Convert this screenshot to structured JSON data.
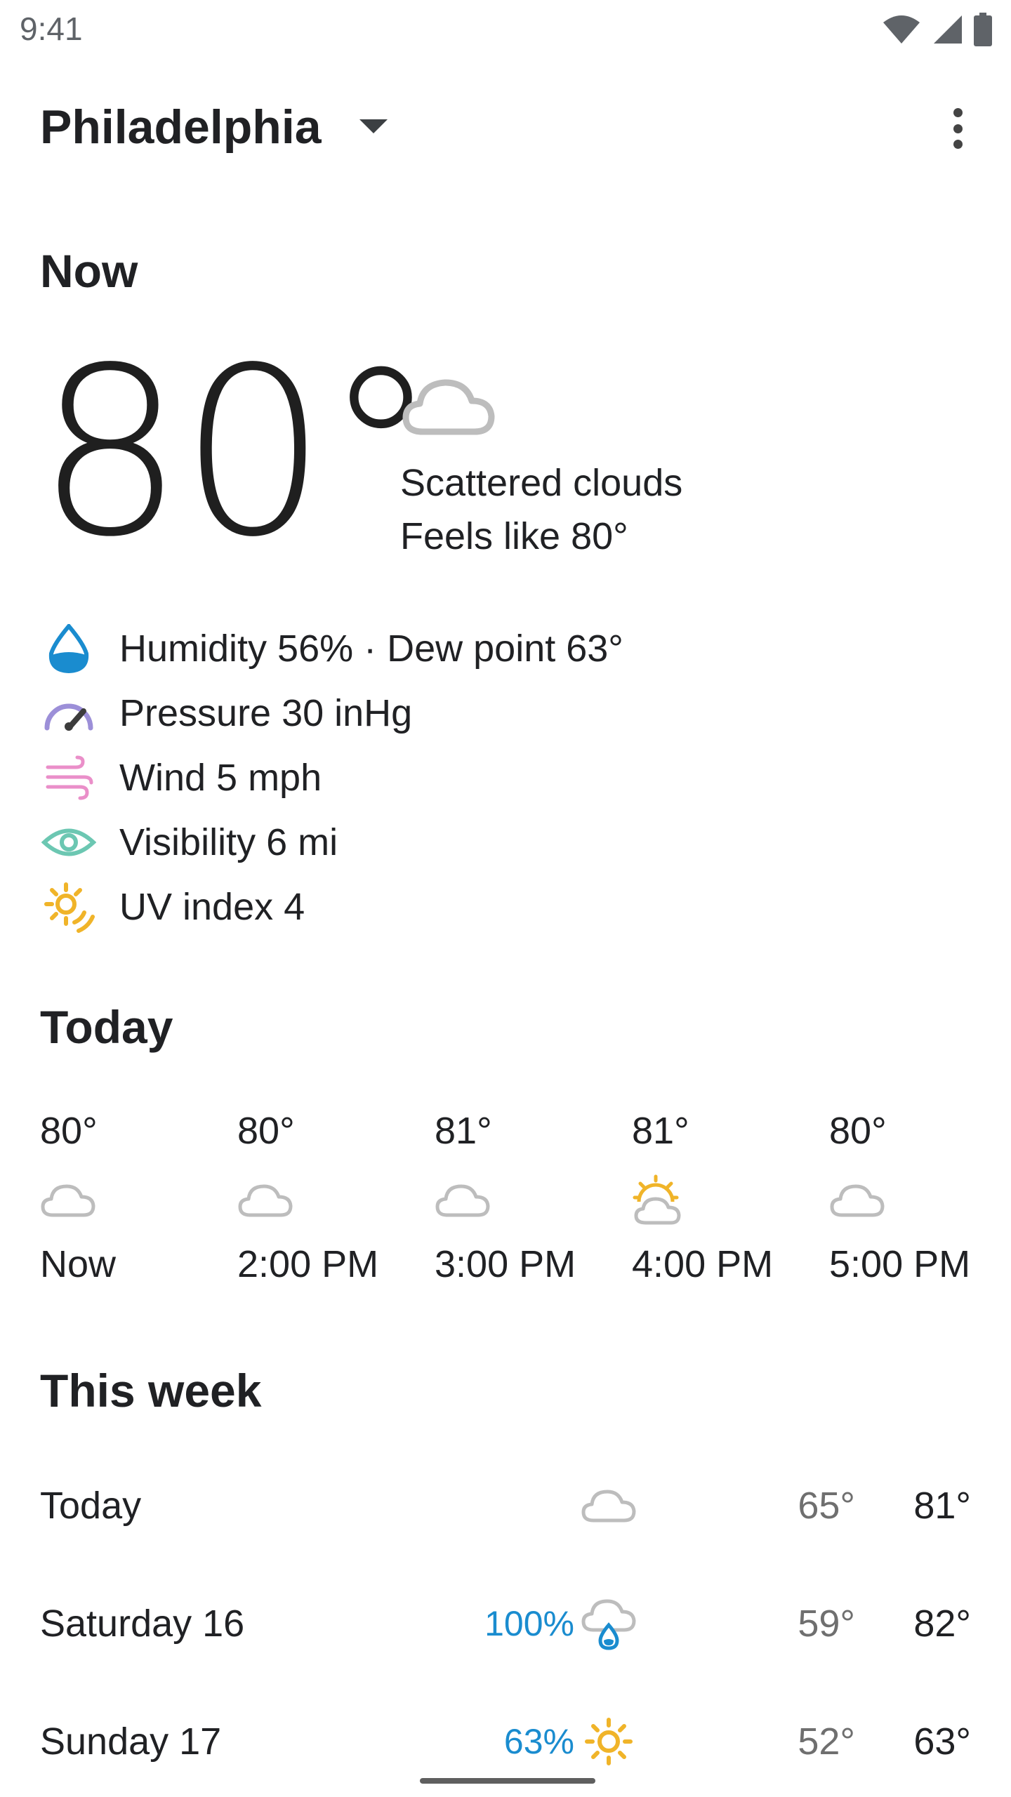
{
  "status_bar": {
    "time": "9:41",
    "icons": [
      "wifi-icon",
      "signal-icon",
      "battery-icon"
    ]
  },
  "header": {
    "location": "Philadelphia",
    "dropdown_icon": "arrow-drop-down-icon",
    "menu_icon": "more-vert-icon"
  },
  "now": {
    "title": "Now",
    "temperature": "80°",
    "condition_icon": "cloud-icon",
    "condition": "Scattered clouds",
    "feels_like": "Feels like 80°",
    "details": [
      {
        "icon": "humidity-drop-icon",
        "text": "Humidity 56% · Dew point 63°",
        "color": "#1a8ccf"
      },
      {
        "icon": "pressure-gauge-icon",
        "text": "Pressure 30 inHg",
        "color": "#9c8fd8"
      },
      {
        "icon": "wind-icon",
        "text": "Wind 5 mph",
        "color": "#ea8fc9"
      },
      {
        "icon": "visibility-eye-icon",
        "text": "Visibility 6 mi",
        "color": "#6cc7b2"
      },
      {
        "icon": "uv-sun-icon",
        "text": "UV index 4",
        "color": "#f0b429"
      }
    ]
  },
  "today": {
    "title": "Today",
    "hours": [
      {
        "temp": "80°",
        "icon": "cloud-icon",
        "label": "Now"
      },
      {
        "temp": "80°",
        "icon": "cloud-icon",
        "label": "2:00 PM"
      },
      {
        "temp": "81°",
        "icon": "cloud-icon",
        "label": "3:00 PM"
      },
      {
        "temp": "81°",
        "icon": "partly-sunny-icon",
        "label": "4:00 PM"
      },
      {
        "temp": "80°",
        "icon": "cloud-icon",
        "label": "5:00 PM"
      }
    ]
  },
  "week": {
    "title": "This week",
    "days": [
      {
        "day": "Today",
        "precip": "",
        "icon": "cloud-icon",
        "low": "65°",
        "high": "81°"
      },
      {
        "day": "Saturday 16",
        "precip": "100%",
        "icon": "rain-cloud-icon",
        "low": "59°",
        "high": "82°"
      },
      {
        "day": "Sunday 17",
        "precip": "63%",
        "icon": "sun-icon",
        "low": "52°",
        "high": "63°"
      }
    ]
  },
  "colors": {
    "accent_blue": "#1a8ccf",
    "cloud_gray": "#bdbdbd",
    "sun_yellow": "#f0b429"
  }
}
